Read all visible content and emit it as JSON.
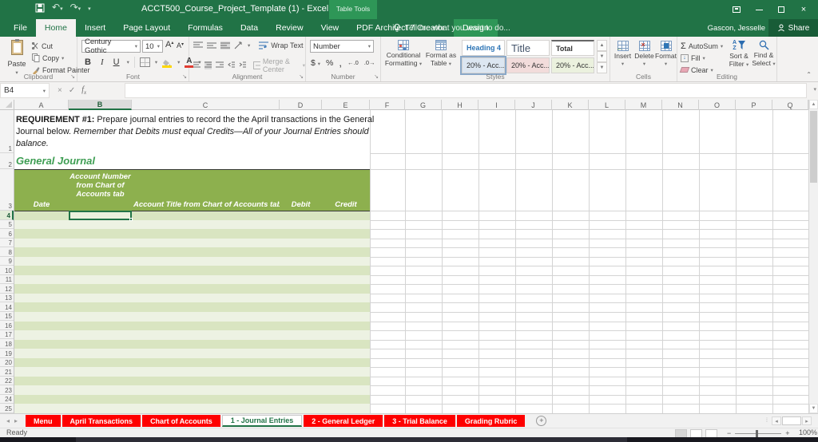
{
  "title_bar": {
    "title": "ACCT500_Course_Project_Template (1) - Excel",
    "context_tab_group": "Table Tools",
    "user_name": "Gascon, Jesselle",
    "share_label": "Share"
  },
  "menu": {
    "tabs": [
      "File",
      "Home",
      "Insert",
      "Page Layout",
      "Formulas",
      "Data",
      "Review",
      "View",
      "PDF Architect 7 Creator",
      "Design"
    ],
    "active_tab": "Home",
    "contextual_tab": "Design",
    "tell_me": "Tell me what you want to do..."
  },
  "ribbon": {
    "clipboard": {
      "label": "Clipboard",
      "paste": "Paste",
      "cut": "Cut",
      "copy": "Copy",
      "format_painter": "Format Painter"
    },
    "font": {
      "label": "Font",
      "font_name": "Century Gothic",
      "font_size": "10",
      "bold": "B",
      "italic": "I",
      "underline": "U"
    },
    "alignment": {
      "label": "Alignment",
      "wrap_text": "Wrap Text",
      "merge_center": "Merge & Center"
    },
    "number": {
      "label": "Number",
      "format": "Number",
      "currency": "$",
      "percent": "%",
      "comma": ",",
      "inc_decimal": "←.0",
      "dec_decimal": ".0→"
    },
    "styles": {
      "label": "Styles",
      "conditional_formatting": "Conditional Formatting",
      "format_as_table": "Format as Table",
      "gallery": [
        {
          "name": "Heading 4",
          "row": 1,
          "kind": "heading4"
        },
        {
          "name": "Title",
          "row": 1,
          "kind": "title"
        },
        {
          "name": "Total",
          "row": 1,
          "kind": "total"
        },
        {
          "name": "20% - Acc...",
          "row": 2,
          "kind": "accent-blue",
          "bg": "#DCE6F1",
          "selected": true
        },
        {
          "name": "20% - Acc...",
          "row": 2,
          "kind": "accent-red",
          "bg": "#F2DCDB",
          "selected": false
        },
        {
          "name": "20% - Acc...",
          "row": 2,
          "kind": "accent-green",
          "bg": "#EBF1DE",
          "selected": false
        }
      ]
    },
    "cells": {
      "label": "Cells",
      "insert": "Insert",
      "delete": "Delete",
      "format": "Format"
    },
    "editing": {
      "label": "Editing",
      "autosum": "AutoSum",
      "fill": "Fill",
      "clear": "Clear",
      "sort_filter": "Sort & Filter",
      "find_select": "Find & Select"
    }
  },
  "formula_bar": {
    "name_box": "B4",
    "formula_value": ""
  },
  "sheet": {
    "columns": [
      "A",
      "B",
      "C",
      "D",
      "E",
      "F",
      "G",
      "H",
      "I",
      "J",
      "K",
      "L",
      "M",
      "N",
      "O",
      "P",
      "Q"
    ],
    "selected_column": "B",
    "selected_row": 4,
    "selected_cell": "B4",
    "visible_rows": 25,
    "requirement": {
      "bold": "REQUIREMENT #1:",
      "normal": " Prepare journal entries to record the the April transactions in the General Journal below. ",
      "italic": "Remember that Debits must equal Credits—All of your Journal Entries should balance."
    },
    "section_title": "General Journal",
    "table_headers": [
      "Date",
      "Account Number from Chart of Accounts tab",
      "Account Title from Chart of Accounts tab",
      "Debit",
      "Credit"
    ]
  },
  "sheet_tabs": {
    "tabs": [
      "Menu",
      "April Transactions",
      "Chart of Accounts",
      "1 - Journal Entries",
      "2 - General Ledger",
      "3 - Trial Balance",
      "Grading Rubric"
    ],
    "active": "1 - Journal Entries"
  },
  "status_bar": {
    "mode": "Ready",
    "zoom": "100%"
  },
  "colors": {
    "excel_green": "#217346",
    "contextual_green": "#2e9657",
    "table_header_olive": "#8DB04E",
    "band_dark": "#D9E5C1",
    "band_light": "#EDF2E3",
    "sheet_tab_red": "#FE0000",
    "section_title_green": "#3E9E53",
    "header_border_dark": "#3a3a3a"
  }
}
